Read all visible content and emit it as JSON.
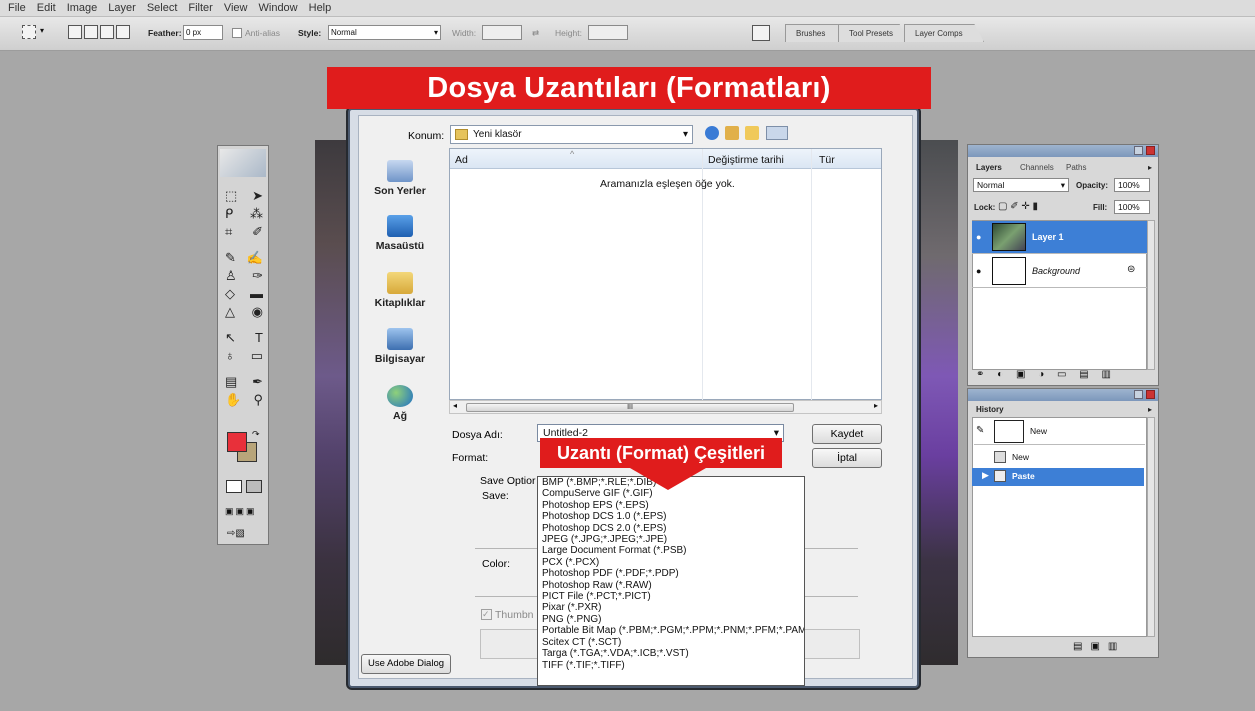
{
  "menu": [
    "File",
    "Edit",
    "Image",
    "Layer",
    "Select",
    "Filter",
    "View",
    "Window",
    "Help"
  ],
  "options_bar": {
    "feather_label": "Feather:",
    "feather_value": "0 px",
    "antialias_label": "Anti-alias",
    "style_label": "Style:",
    "style_value": "Normal",
    "width_label": "Width:",
    "height_label": "Height:",
    "tabs": [
      "Brushes",
      "Tool Presets",
      "Layer Comps"
    ]
  },
  "overlay": {
    "title": "Dosya Uzantıları (Formatları)",
    "subtitle": "Uzantı (Format) Çeşitleri"
  },
  "dialog": {
    "location_label": "Konum:",
    "location_value": "Yeni klasör",
    "places": [
      "Son Yerler",
      "Masaüstü",
      "Kitaplıklar",
      "Bilgisayar",
      "Ağ"
    ],
    "columns": [
      "Ad",
      "Değiştirme tarihi",
      "Tür"
    ],
    "empty_message": "Aramanızla eşleşen öğe yok.",
    "filename_label": "Dosya Adı:",
    "filename_value": "Untitled-2",
    "format_label": "Format:",
    "save_button": "Kaydet",
    "cancel_button": "İptal",
    "save_options_label": "Save Optior",
    "save_label": "Save:",
    "color_label": "Color:",
    "thumbnail_label": "Thumbn",
    "adobe_dialog_button": "Use Adobe Dialog",
    "scroll_glyph": "III",
    "formats": [
      "BMP (*.BMP;*.RLE;*.DIB)",
      "CompuServe GIF (*.GIF)",
      "Photoshop EPS (*.EPS)",
      "Photoshop DCS 1.0 (*.EPS)",
      "Photoshop DCS 2.0 (*.EPS)",
      "JPEG (*.JPG;*.JPEG;*.JPE)",
      "Large Document Format (*.PSB)",
      "PCX (*.PCX)",
      "Photoshop PDF (*.PDF;*.PDP)",
      "Photoshop Raw (*.RAW)",
      "PICT File (*.PCT;*.PICT)",
      "Pixar (*.PXR)",
      "PNG (*.PNG)",
      "Portable Bit Map (*.PBM;*.PGM;*.PPM;*.PNM;*.PFM;*.PAM)",
      "Scitex CT (*.SCT)",
      "Targa (*.TGA;*.VDA;*.ICB;*.VST)",
      "TIFF (*.TIF;*.TIFF)"
    ]
  },
  "layers_panel": {
    "tabs": [
      "Layers",
      "Channels",
      "Paths"
    ],
    "blend_mode": "Normal",
    "opacity_label": "Opacity:",
    "opacity_value": "100%",
    "lock_label": "Lock:",
    "fill_label": "Fill:",
    "fill_value": "100%",
    "layers": [
      "Layer 1",
      "Background"
    ]
  },
  "history_panel": {
    "tab": "History",
    "snapshot": "New",
    "items": [
      "New",
      "Paste"
    ]
  },
  "colors": {
    "banner_red": "#e01c1c",
    "foreground_color": "#e8303a",
    "background_color": "#b8a57a",
    "selection_blue": "#3d7fd6"
  }
}
